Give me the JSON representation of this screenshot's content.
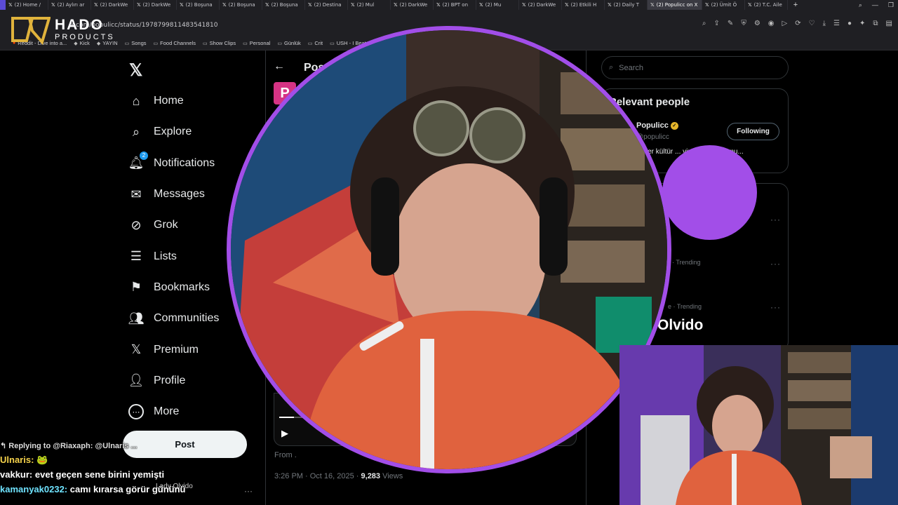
{
  "browser": {
    "tabs": [
      {
        "label": "(2) Home /"
      },
      {
        "label": "(2) Aylırı ar"
      },
      {
        "label": "(2) DarkWe"
      },
      {
        "label": "(2) DarkWe"
      },
      {
        "label": "(2) Boşuna"
      },
      {
        "label": "(2) Boşuna"
      },
      {
        "label": "(2) Boşuna"
      },
      {
        "label": "(2) Destina"
      },
      {
        "label": "(2) Mul"
      },
      {
        "label": "(2) DarkWe"
      },
      {
        "label": "(2) BPT on"
      },
      {
        "label": "(2) Mu"
      },
      {
        "label": "(2) DarkWe"
      },
      {
        "label": "(2) Etkili H"
      },
      {
        "label": "(2) Daily T"
      },
      {
        "label": "(2) Populicc on X"
      },
      {
        "label": "(2) Ümit Ö"
      },
      {
        "label": "(2) T.C. Aile"
      }
    ],
    "active_tab_index": 15,
    "url": "x.com/populicc/status/1978799811483541810",
    "bookmarks": [
      {
        "label": "Reddit - Dive into a..."
      },
      {
        "label": "Kick"
      },
      {
        "label": "YAYIN"
      },
      {
        "label": "Songs"
      },
      {
        "label": "Food Channels"
      },
      {
        "label": "Show Clips"
      },
      {
        "label": "Personal"
      },
      {
        "label": "Günlük"
      },
      {
        "label": "Crit"
      },
      {
        "label": "USH - I Beat Loneli..."
      }
    ]
  },
  "overlay_logo": {
    "name": "HADO",
    "sub": "PRODUCTS"
  },
  "x_sidebar": {
    "logo": "𝕏",
    "nav": [
      {
        "label": "Home",
        "icon": "home-icon"
      },
      {
        "label": "Explore",
        "icon": "search-icon"
      },
      {
        "label": "Notifications",
        "icon": "bell-icon",
        "badge": "2"
      },
      {
        "label": "Messages",
        "icon": "envelope-icon"
      },
      {
        "label": "Grok",
        "icon": "grok-icon"
      },
      {
        "label": "Lists",
        "icon": "list-icon"
      },
      {
        "label": "Bookmarks",
        "icon": "bookmark-icon"
      },
      {
        "label": "Communities",
        "icon": "people-icon"
      },
      {
        "label": "Premium",
        "icon": "x-icon"
      },
      {
        "label": "Profile",
        "icon": "person-icon"
      },
      {
        "label": "More",
        "icon": "more-icon"
      }
    ],
    "post_button": "Post"
  },
  "post": {
    "header_title": "Post",
    "avatar_letter": "P",
    "from_label": "From .",
    "time": "3:26 PM · Oct 16, 2025 · ",
    "views_count": "9,283",
    "views_label": " Views",
    "video_progress": 0.05
  },
  "right_column": {
    "search_placeholder": "Search",
    "relevant_title": "Relevant people",
    "person": {
      "name": "Populicc",
      "handle": "@populicc",
      "bio": "...üler kültür ... viral içerik ...ormu...",
      "follow_label": "Following"
    },
    "trends": [
      {
        "meta": "· Trending"
      },
      {
        "meta": "e · Trending"
      }
    ],
    "trend_big": "Olvido"
  },
  "chat": {
    "reply_text": "Replying to @Riaxaph: @Ulnaris ...",
    "messages": [
      {
        "user": "Ulnaris:",
        "text": "🐸",
        "color": "#f5d24b"
      },
      {
        "user": "vakkur:",
        "text": "evet geçen sene birini yemişti",
        "color": "#ffffff"
      },
      {
        "user": "kamanyak0232:",
        "text": "camı kırarsa görür gününü",
        "color": "#6fe3ff"
      }
    ],
    "card_label": "Lady Olvido"
  },
  "colors": {
    "accent_purple": "#a24ee8",
    "x_blue": "#1d9bf0",
    "verified_gold": "#e4b52b"
  }
}
